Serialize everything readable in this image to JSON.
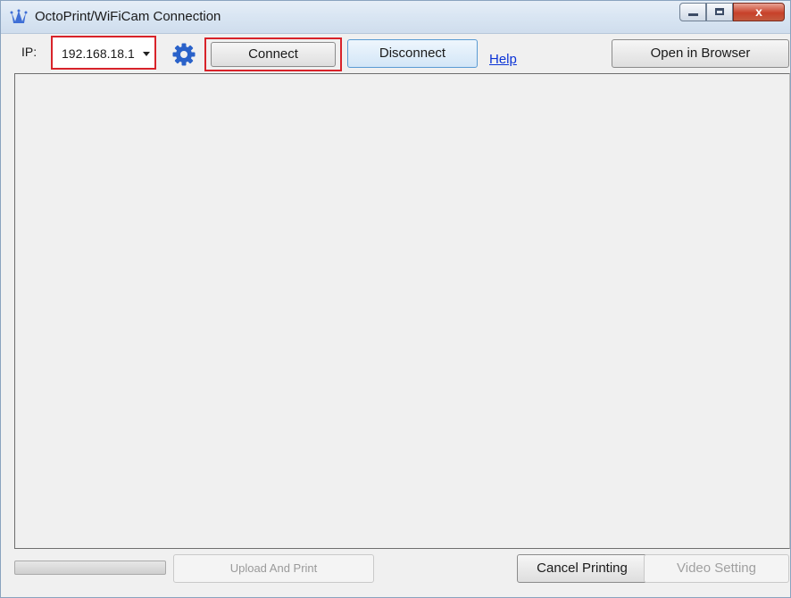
{
  "window": {
    "title": "OctoPrint/WiFiCam Connection",
    "close_glyph": "x"
  },
  "toolbar": {
    "ip_label": "IP:",
    "ip_value": "192.168.18.1",
    "connect_label": "Connect",
    "disconnect_label": "Disconnect",
    "help_label": "Help",
    "open_browser_label": "Open in Browser"
  },
  "footer": {
    "progress": 0,
    "upload_label": "Upload And Print",
    "cancel_label": "Cancel Printing",
    "video_label": "Video Setting"
  },
  "icons": {
    "app": "octoprint-crown-icon",
    "settings": "gear-icon",
    "dropdown": "chevron-down-icon"
  },
  "colors": {
    "highlight": "#d8232a",
    "gear": "#2a62c9",
    "link": "#0b33d6"
  }
}
